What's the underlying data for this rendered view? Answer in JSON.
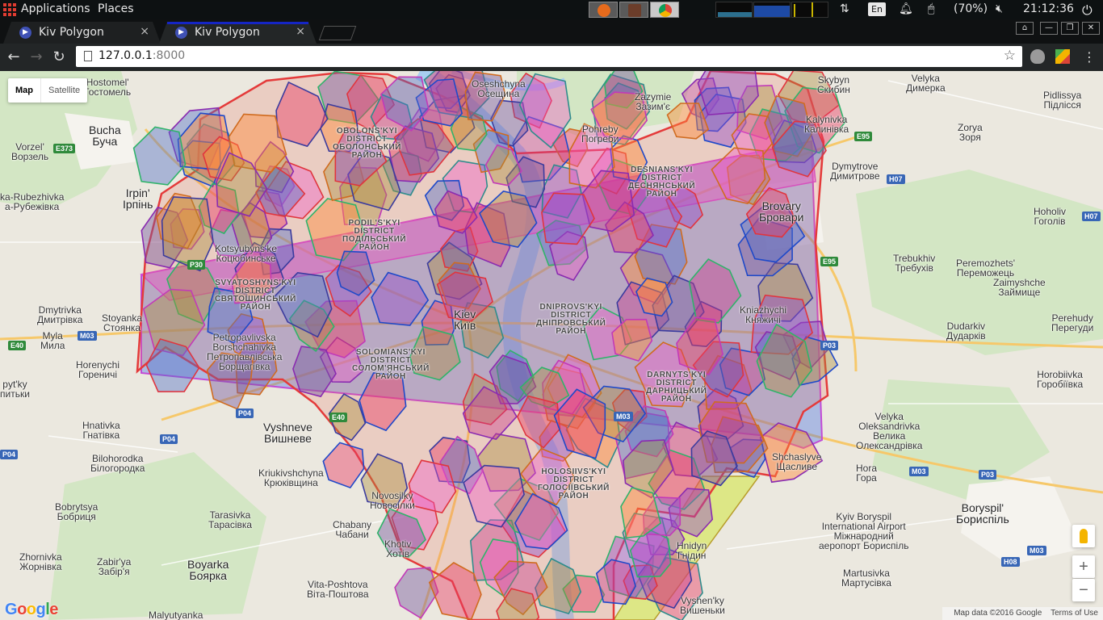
{
  "desktop_panel": {
    "applications_label": "Applications",
    "places_label": "Places",
    "tray": {
      "language": "En",
      "battery": "(70%)",
      "clock": "21:12:36"
    }
  },
  "browser": {
    "tabs": [
      {
        "title": "Kiv Polygon",
        "active": false
      },
      {
        "title": "Kiv Polygon",
        "active": true
      }
    ],
    "tab_close_glyph": "×",
    "url_host": "127.0.0.1",
    "url_port": ":8000",
    "nav": {
      "back": "←",
      "forward": "→",
      "reload": "↻"
    },
    "star_glyph": "☆",
    "window_controls": {
      "user": "⌂",
      "minimize": "—",
      "restore": "❐",
      "close": "✕"
    }
  },
  "map": {
    "type_control": {
      "map_label": "Map",
      "satellite_label": "Satellite"
    },
    "zoom_in": "+",
    "zoom_out": "−",
    "logo": "Google",
    "attribution": {
      "data": "Map data ©2016 Google",
      "terms": "Terms of Use"
    },
    "places": [
      {
        "id": "hostomel",
        "text": "Hostomel'\nГостомель",
        "cls": ""
      },
      {
        "id": "bucha",
        "text": "Bucha\nБуча",
        "cls": "big"
      },
      {
        "id": "vorzel",
        "text": "Vorzel'\nВорзель",
        "cls": ""
      },
      {
        "id": "irpin",
        "text": "Irpin'\nІрпінь",
        "cls": "big"
      },
      {
        "id": "rubezhivka",
        "text": "ka-Rubezhivka\nа-Рубежівка",
        "cls": ""
      },
      {
        "id": "dmytrivka",
        "text": "Dmytrivka\nДмитрівка",
        "cls": ""
      },
      {
        "id": "stoyanka",
        "text": "Stoyanka\nСтоянка",
        "cls": ""
      },
      {
        "id": "myla",
        "text": "Myla\nМила",
        "cls": ""
      },
      {
        "id": "horenychi",
        "text": "Horenychi\nГореничі",
        "cls": ""
      },
      {
        "id": "pytky",
        "text": "pyt'ky\nпитьки",
        "cls": ""
      },
      {
        "id": "hnativka",
        "text": "Hnatіvka\nГнатівка",
        "cls": ""
      },
      {
        "id": "bilohorodka",
        "text": "Bilohorodka\nБілогородка",
        "cls": ""
      },
      {
        "id": "bobrytsya",
        "text": "Bobrytsya\nБобриця",
        "cls": ""
      },
      {
        "id": "zhornivka",
        "text": "Zhornivka\nЖорнівка",
        "cls": ""
      },
      {
        "id": "kriukivshchyna",
        "text": "Kriukivshchyna\nКрюківщина",
        "cls": ""
      },
      {
        "id": "tarasivka",
        "text": "Tarasivka\nТарасівка",
        "cls": ""
      },
      {
        "id": "chabany",
        "text": "Chabany\nЧабани",
        "cls": ""
      },
      {
        "id": "boyarka",
        "text": "Boyarka\nБоярка",
        "cls": "big"
      },
      {
        "id": "zabirya",
        "text": "Zabir'ya\nЗабір'я",
        "cls": ""
      },
      {
        "id": "vitaposhtova",
        "text": "Vita-Poshtova\nВіта-Поштова",
        "cls": ""
      },
      {
        "id": "malyutyanka",
        "text": "Malyutyanka",
        "cls": ""
      },
      {
        "id": "vyshneve",
        "text": "Vyshneve\nВишневе",
        "cls": "big"
      },
      {
        "id": "khotiv",
        "text": "Khotiv\nХотів",
        "cls": ""
      },
      {
        "id": "novosilky",
        "text": "Novosilky\nНовосілки",
        "cls": ""
      },
      {
        "id": "hnidyn",
        "text": "Hnidyn\nГнідин",
        "cls": ""
      },
      {
        "id": "vyshenky",
        "text": "Vyshen'ky\nВишеньки",
        "cls": ""
      },
      {
        "id": "osheshchyna",
        "text": "Oseshchyna\nОсещина",
        "cls": ""
      },
      {
        "id": "zazymie",
        "text": "Zazymie\nЗазим'є",
        "cls": ""
      },
      {
        "id": "pohreby",
        "text": "Pohreby\nПогреби",
        "cls": ""
      },
      {
        "id": "skybyn",
        "text": "Skybyn\nСкибин",
        "cls": ""
      },
      {
        "id": "velyka_dymerka",
        "text": "Velyka\nДимерка",
        "cls": ""
      },
      {
        "id": "pidlissya",
        "text": "Pidlissya\nПідлісся",
        "cls": ""
      },
      {
        "id": "kalynivka",
        "text": "Kalynivka\nКалинівка",
        "cls": ""
      },
      {
        "id": "zorya",
        "text": "Zorya\nЗоря",
        "cls": ""
      },
      {
        "id": "dymytrove",
        "text": "Dymytrove\nДимитрове",
        "cls": ""
      },
      {
        "id": "brovary",
        "text": "Brovary\nБровари",
        "cls": "big"
      },
      {
        "id": "hoholiv",
        "text": "Hoholiv\nГоголів",
        "cls": ""
      },
      {
        "id": "trebukhiv",
        "text": "Trebukhiv\nТребухів",
        "cls": ""
      },
      {
        "id": "peremozhets",
        "text": "Peremozhets'\nПереможець",
        "cls": ""
      },
      {
        "id": "zaimyshche",
        "text": "Zaimyshche\nЗаймище",
        "cls": ""
      },
      {
        "id": "kniazhychi",
        "text": "Kniazhychi\nКняжичі",
        "cls": ""
      },
      {
        "id": "dudarkiv",
        "text": "Dudarkiv\nДударків",
        "cls": ""
      },
      {
        "id": "perehudy",
        "text": "Perehudy\nПерегуди",
        "cls": ""
      },
      {
        "id": "horobiivka",
        "text": "Horobiivka\nГоробіївка",
        "cls": ""
      },
      {
        "id": "velyka_oleksandrivka",
        "text": "Velyka\nOleksandrivka\nВелика\nОлександрівка",
        "cls": ""
      },
      {
        "id": "shchaslyve",
        "text": "Shchaslyve\nЩасливе",
        "cls": ""
      },
      {
        "id": "hora",
        "text": "Hora\nГора",
        "cls": ""
      },
      {
        "id": "airport",
        "text": "Kyiv Boryspil\nInternational Airport\nМіжнародний\nаеропорт Бориспіль",
        "cls": ""
      },
      {
        "id": "boryspil",
        "text": "Boryspil'\nБориспіль",
        "cls": "big"
      },
      {
        "id": "martusivka",
        "text": "Martusivka\nМартусівка",
        "cls": ""
      },
      {
        "id": "kyiv",
        "text": "Kiev\nКиїв",
        "cls": "big"
      },
      {
        "id": "obolonskyi",
        "text": "OBOLONS'KYI\nDISTRICT\nОБОЛОНСЬКИЙ\nРАЙОН",
        "cls": "district"
      },
      {
        "id": "podilskyi",
        "text": "PODIL'S'KYI\nDISTRICT\nПОДІЛЬСЬКИЙ\nРАЙОН",
        "cls": "district"
      },
      {
        "id": "sviatoshynskyi",
        "text": "SVYATOSHYNS'KYI\nDISTRICT\nСВЯТОШИНСЬКИЙ\nРАЙОН",
        "cls": "district"
      },
      {
        "id": "dniprovskyi",
        "text": "DNIPROVS'KYI\nDISTRICT\nДНІПРОВСЬКИЙ\nРАЙОН",
        "cls": "district"
      },
      {
        "id": "holosiivskyi",
        "text": "HOLOSIIVS'KYI\nDISTRICT\nГОЛОСІЇВСЬКИЙ\nРАЙОН",
        "cls": "district"
      },
      {
        "id": "solomianskyi",
        "text": "SOLOMIANS'KYI\nDISTRICT\nСОЛОМ'ЯНСЬКИЙ\nРАЙОН",
        "cls": "district"
      },
      {
        "id": "darnytskyi",
        "text": "DARNYTS'KYI\nDISTRICT\nДАРНИЦЬКИЙ\nРАЙОН",
        "cls": "district"
      },
      {
        "id": "desnianskyi",
        "text": "DESNIANS'KYI\nDISTRICT\nДЕСНЯНСЬКИЙ\nРАЙОН",
        "cls": "district"
      },
      {
        "id": "kotsiubynske",
        "text": "Kotsyubyns'ke\nКоцюбинське",
        "cls": ""
      },
      {
        "id": "borshchahivka",
        "text": "Petropavlivska\nBorshchahivka\nПетропавлівська\nБорщагівка",
        "cls": ""
      }
    ],
    "road_shields": [
      {
        "id": "e373",
        "text": "E373",
        "cls": ""
      },
      {
        "id": "m03w",
        "text": "M03",
        "cls": "blue"
      },
      {
        "id": "e40",
        "text": "E40",
        "cls": ""
      },
      {
        "id": "p04a",
        "text": "P04",
        "cls": "blue"
      },
      {
        "id": "p04b",
        "text": "P04",
        "cls": "blue"
      },
      {
        "id": "p04c",
        "text": "P04",
        "cls": "blue"
      },
      {
        "id": "e95",
        "text": "E95",
        "cls": ""
      },
      {
        "id": "h07a",
        "text": "H07",
        "cls": "blue"
      },
      {
        "id": "h07b",
        "text": "H07",
        "cls": "blue"
      },
      {
        "id": "e95b",
        "text": "E95",
        "cls": ""
      },
      {
        "id": "p03",
        "text": "P03",
        "cls": "blue"
      },
      {
        "id": "m03e",
        "text": "M03",
        "cls": "blue"
      },
      {
        "id": "p03b",
        "text": "P03",
        "cls": "blue"
      },
      {
        "id": "h08",
        "text": "H08",
        "cls": "blue"
      },
      {
        "id": "m03f",
        "text": "M03",
        "cls": "blue"
      },
      {
        "id": "m03c",
        "text": "M03",
        "cls": "blue"
      },
      {
        "id": "p30",
        "text": "P30",
        "cls": ""
      },
      {
        "id": "e40b",
        "text": "E40",
        "cls": ""
      }
    ]
  }
}
